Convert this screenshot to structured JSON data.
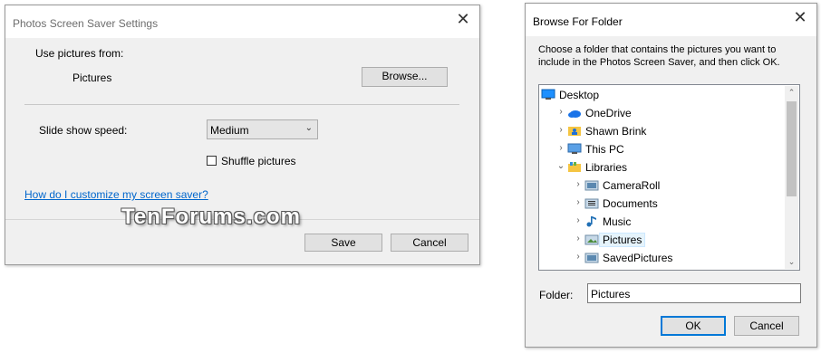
{
  "photos_dialog": {
    "title": "Photos Screen Saver Settings",
    "close_glyph": "✕",
    "use_pictures_label": "Use pictures from:",
    "folder_value": "Pictures",
    "browse_label": "Browse...",
    "slide_speed_label": "Slide show speed:",
    "slide_speed_value": "Medium",
    "shuffle_label": "Shuffle pictures",
    "shuffle_checked": false,
    "help_link": "How do I customize my screen saver?",
    "save_label": "Save",
    "cancel_label": "Cancel"
  },
  "watermark": "TenForums.com",
  "browse_dialog": {
    "title": "Browse For Folder",
    "close_glyph": "✕",
    "instructions_line1": "Choose a folder that contains the pictures you want to",
    "instructions_line2": "include in the Photos Screen Saver, and then click OK.",
    "tree": [
      {
        "label": "Desktop",
        "level": 0,
        "chevron": "",
        "icon": "desktop-icon"
      },
      {
        "label": "OneDrive",
        "level": 1,
        "chevron": "›",
        "icon": "onedrive-icon"
      },
      {
        "label": "Shawn Brink",
        "level": 1,
        "chevron": "›",
        "icon": "user-folder-icon"
      },
      {
        "label": "This PC",
        "level": 1,
        "chevron": "›",
        "icon": "this-pc-icon"
      },
      {
        "label": "Libraries",
        "level": 1,
        "chevron": "⌄",
        "icon": "libraries-icon"
      },
      {
        "label": "CameraRoll",
        "level": 2,
        "chevron": "›",
        "icon": "library-folder-icon"
      },
      {
        "label": "Documents",
        "level": 2,
        "chevron": "›",
        "icon": "documents-library-icon"
      },
      {
        "label": "Music",
        "level": 2,
        "chevron": "›",
        "icon": "music-library-icon"
      },
      {
        "label": "Pictures",
        "level": 2,
        "chevron": "›",
        "icon": "pictures-library-icon",
        "selected": true
      },
      {
        "label": "SavedPictures",
        "level": 2,
        "chevron": "›",
        "icon": "library-folder-icon"
      },
      {
        "label": "",
        "level": 2,
        "chevron": "›",
        "icon": "library-folder-icon"
      }
    ],
    "folder_label": "Folder:",
    "folder_value": "Pictures",
    "ok_label": "OK",
    "cancel_label": "Cancel"
  },
  "colors": {
    "dialog_bg": "#f0f0f0",
    "titlebar_bg": "#ffffff",
    "link": "#0066cc",
    "default_button_border": "#0078d7"
  }
}
